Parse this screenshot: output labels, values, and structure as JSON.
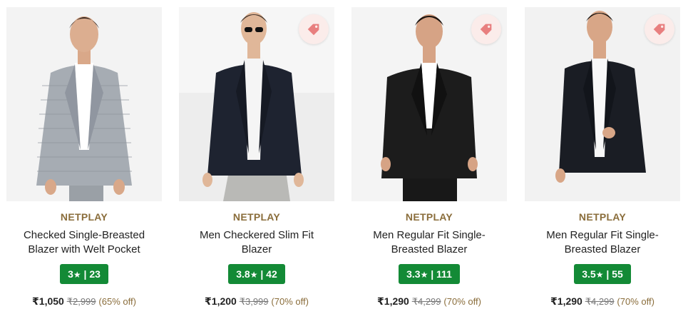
{
  "products": [
    {
      "brand": "NETPLAY",
      "name": "Checked Single-Breasted Blazer with Welt Pocket",
      "rating": "3",
      "rating_count": "23",
      "price": "₹1,050",
      "mrp": "₹2,999",
      "discount": "(65% off)",
      "has_wishlist_icon": false,
      "blazer_color": "#a6acb3",
      "bg_color": "#f3f3f3"
    },
    {
      "brand": "NETPLAY",
      "name": "Men Checkered Slim Fit Blazer",
      "rating": "3.8",
      "rating_count": "42",
      "price": "₹1,200",
      "mrp": "₹3,999",
      "discount": "(70% off)",
      "has_wishlist_icon": true,
      "blazer_color": "#1e2330",
      "bg_color": "#ededed"
    },
    {
      "brand": "NETPLAY",
      "name": "Men Regular Fit Single-Breasted Blazer",
      "rating": "3.3",
      "rating_count": "111",
      "price": "₹1,290",
      "mrp": "₹4,299",
      "discount": "(70% off)",
      "has_wishlist_icon": true,
      "blazer_color": "#1c1c1c",
      "bg_color": "#f4f4f4"
    },
    {
      "brand": "NETPLAY",
      "name": "Men Regular Fit Single-Breasted Blazer",
      "rating": "3.5",
      "rating_count": "55",
      "price": "₹1,290",
      "mrp": "₹4,299",
      "discount": "(70% off)",
      "has_wishlist_icon": true,
      "blazer_color": "#1a1d24",
      "bg_color": "#eeeeee"
    }
  ],
  "colors": {
    "brand_text": "#8a6d3b",
    "rating_bg": "#138a36",
    "wishlist_bg": "#fbecea",
    "wishlist_icon": "#e87f7f"
  },
  "icons": {
    "rating": "star-icon",
    "wishlist": "price-tag-icon"
  }
}
